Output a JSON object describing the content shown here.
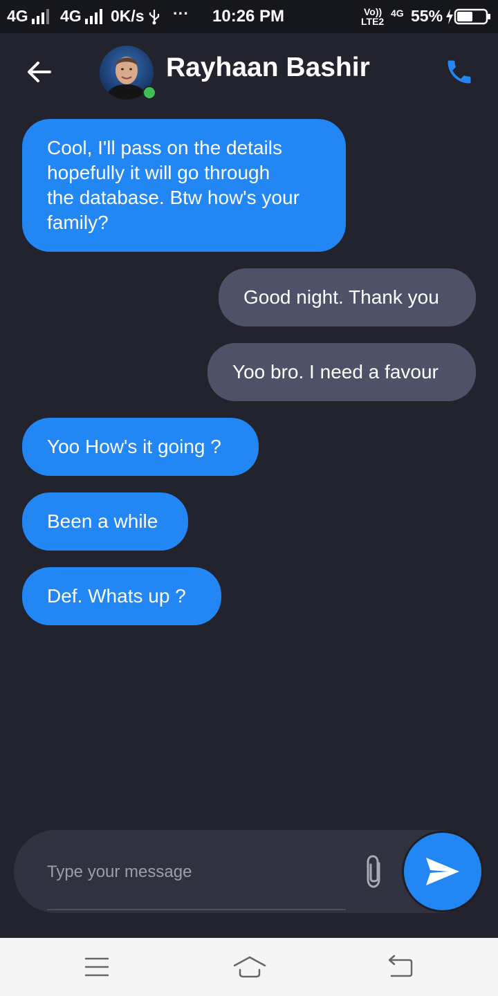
{
  "status_bar": {
    "signal1": "4G",
    "signal2": "4G",
    "speed": "0K/s",
    "more": "···",
    "time": "10:26 PM",
    "volte": "Vo))",
    "lte": "LTE2",
    "net": "4G",
    "battery": "55%",
    "battery_level": 0.55
  },
  "header": {
    "contact_name": "Rayhaan Bashir",
    "online": true
  },
  "messages": [
    {
      "side": "incoming",
      "lines": [
        "Cool, I'll pass on the details",
        "hopefully it will go through",
        "the database. Btw how's your",
        "family?"
      ]
    },
    {
      "side": "outgoing",
      "text": "Good night. Thank you"
    },
    {
      "side": "outgoing",
      "text": "Yoo bro. I need a favour"
    },
    {
      "side": "incoming",
      "text": "Yoo How's it going ?"
    },
    {
      "side": "incoming",
      "text": "Been a while"
    },
    {
      "side": "incoming",
      "text": "Def. Whats up ?"
    }
  ],
  "composer": {
    "placeholder": "Type your message",
    "value": ""
  },
  "colors": {
    "background": "#22232d",
    "incoming_bubble": "#2286f4",
    "outgoing_bubble": "#4e5268",
    "accent": "#2286f4",
    "online_dot": "#3fbf56"
  },
  "icons": {
    "back": "arrow-left",
    "call": "phone",
    "attach": "paperclip",
    "send": "paper-plane",
    "nav_menu": "menu",
    "nav_home": "home",
    "nav_back": "back"
  }
}
